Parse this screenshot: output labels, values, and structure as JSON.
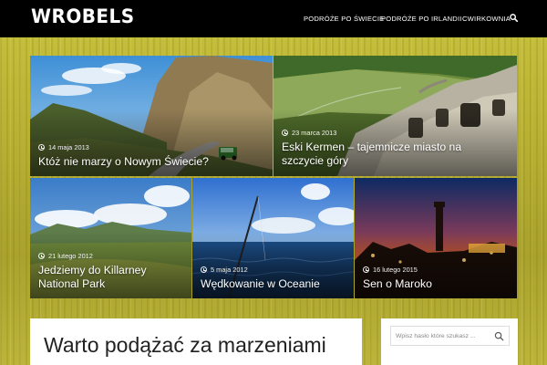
{
  "header": {
    "logo": "WROBELS",
    "nav": [
      "PODRÓŻE PO ŚWIECIE",
      "PODRÓŻE PO IRLANDII",
      "CWIRKOWNIA"
    ],
    "search_icon": "search-icon"
  },
  "featured": [
    {
      "date": "14 maja 2013",
      "title": "Któż nie marzy o Nowym Świecie?"
    },
    {
      "date": "23 marca 2013",
      "title": "Eski Kermen – tajemnicze miasto na szczycie góry"
    },
    {
      "date": "21 lutego 2012",
      "title": "Jedziemy do Killarney National Park"
    },
    {
      "date": "5 maja 2012",
      "title": "Wędkowanie w Oceanie"
    },
    {
      "date": "16 lutego 2015",
      "title": "Sen o Maroko"
    }
  ],
  "main": {
    "heading": "Warto podążać za marzeniami"
  },
  "sidebar": {
    "search_placeholder": "Wpisz hasło które szukasz ...",
    "search_icon": "search-icon"
  },
  "colors": {
    "header_bg": "#000000",
    "background_grass": "#b9b233",
    "text_white": "#ffffff"
  }
}
